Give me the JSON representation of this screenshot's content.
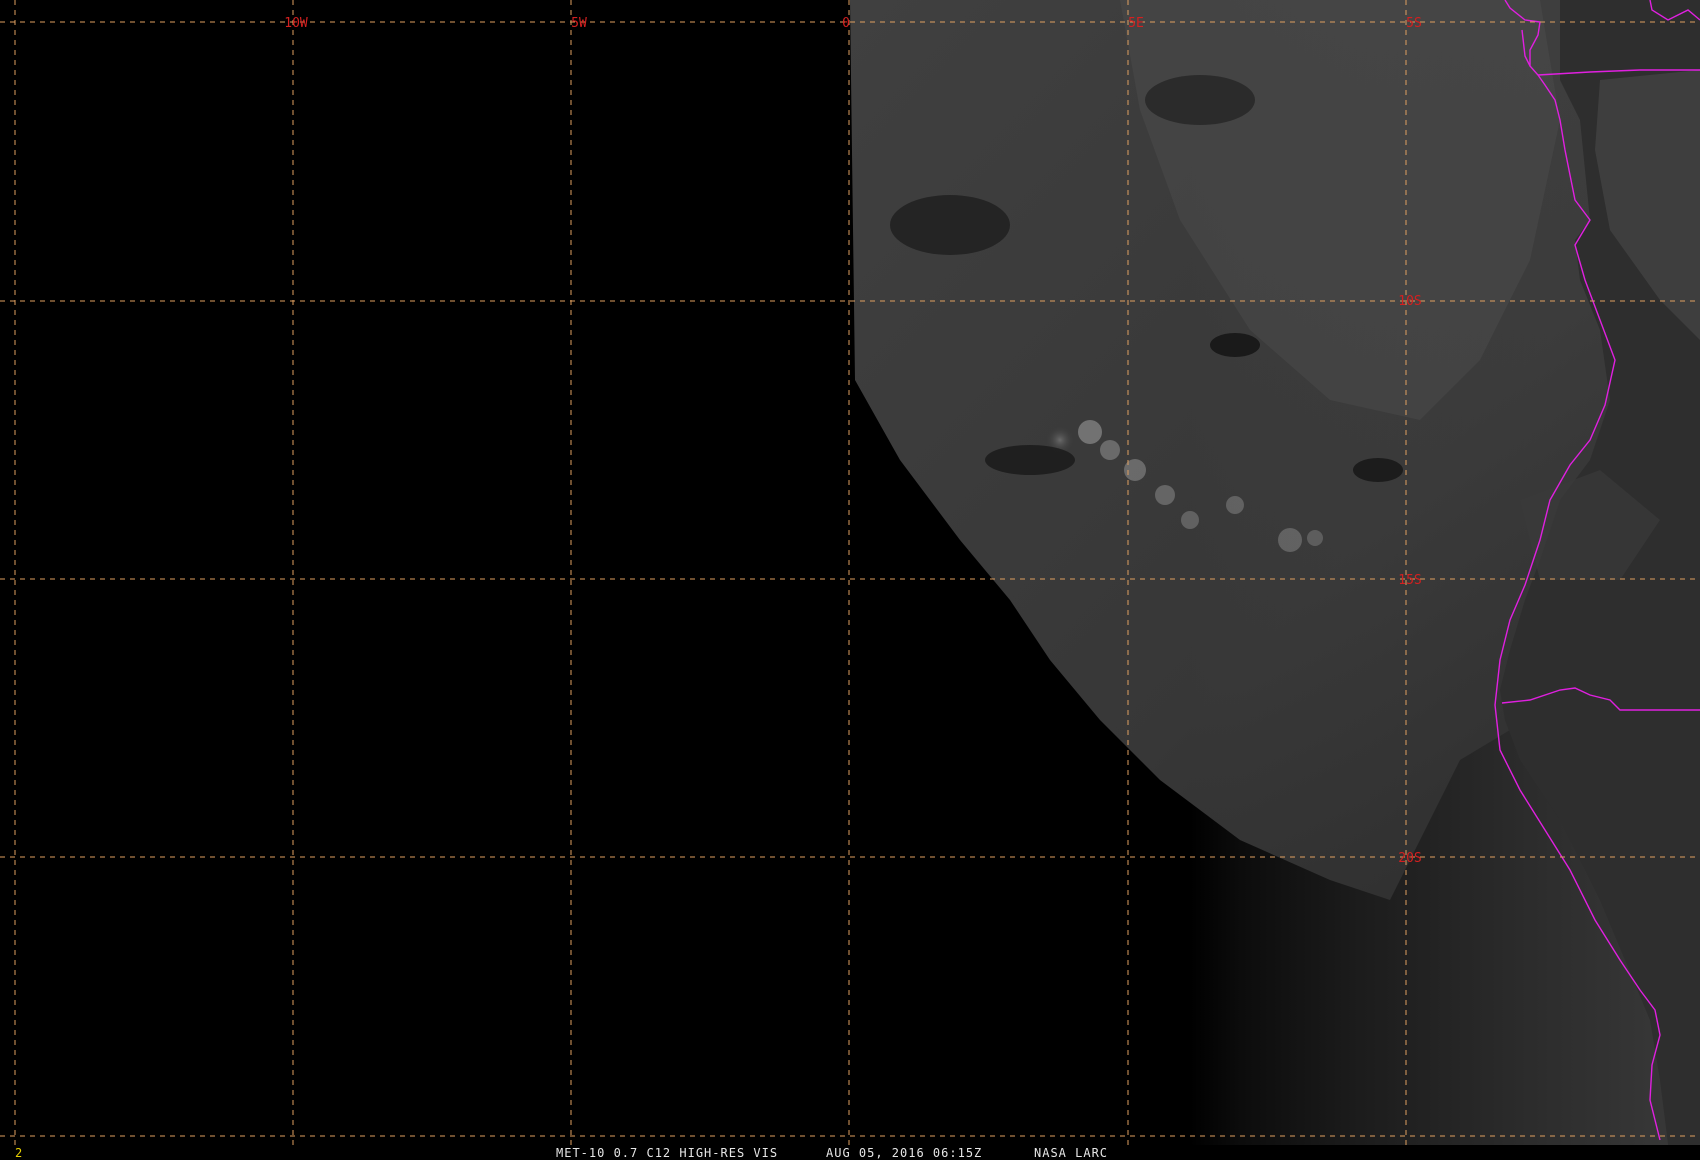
{
  "frame_number": "2",
  "status_bar": {
    "product": "MET-10 0.7 C12 HIGH-RES VIS",
    "datetime": "AUG 05, 2016 06:15Z",
    "source": "NASA LARC"
  },
  "grid": {
    "longitude_labels": [
      "10W",
      "5W",
      "0",
      "5E",
      "5S"
    ],
    "latitude_labels": [
      "10S",
      "15S",
      "20S"
    ]
  },
  "colors": {
    "background": "#000000",
    "gridline": "#e0a060",
    "label": "#d42020",
    "coastline": "#e020e0",
    "status_text": "#e6e6e6",
    "frame_number": "#e8d000"
  }
}
